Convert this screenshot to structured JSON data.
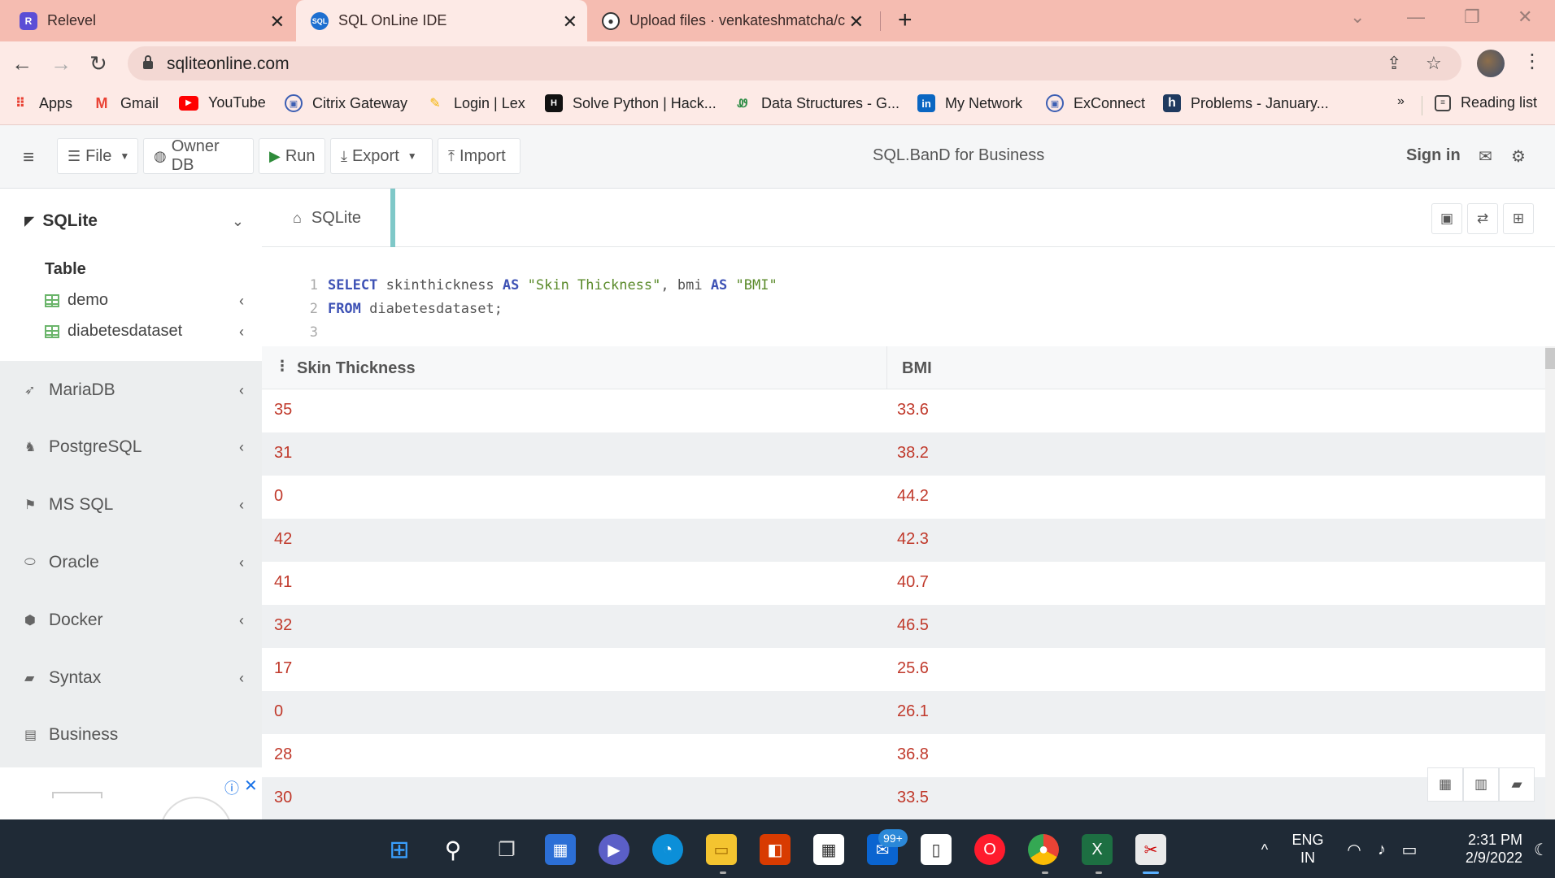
{
  "browser": {
    "tabs": [
      {
        "title": "Relevel",
        "icon": "relevel-icon",
        "active": false
      },
      {
        "title": "SQL OnLine IDE",
        "icon": "sql-cloud-icon",
        "active": true
      },
      {
        "title": "Upload files · venkateshmatcha/c",
        "icon": "github-icon",
        "active": false
      }
    ],
    "url": "sqliteonline.com",
    "bookmarks": [
      {
        "label": "Apps",
        "icon": "apps-grid-icon"
      },
      {
        "label": "Gmail",
        "icon": "gmail-icon"
      },
      {
        "label": "YouTube",
        "icon": "youtube-icon"
      },
      {
        "label": "Citrix Gateway",
        "icon": "citrix-lock-icon"
      },
      {
        "label": "Login | Lex",
        "icon": "lex-icon"
      },
      {
        "label": "Solve Python | Hack...",
        "icon": "hackerrank-icon"
      },
      {
        "label": "Data Structures - G...",
        "icon": "geeksforgeeks-icon"
      },
      {
        "label": "My Network",
        "icon": "linkedin-icon"
      },
      {
        "label": "ExConnect",
        "icon": "exconnect-lock-icon"
      },
      {
        "label": "Problems - January...",
        "icon": "h-icon"
      }
    ],
    "overflow": "»",
    "reading_list": "Reading list"
  },
  "header": {
    "file": "File",
    "owner_db": "Owner DB",
    "run": "Run",
    "export": "Export",
    "import": "Import",
    "brand": "SQL.BanD for Business",
    "sign_in": "Sign in"
  },
  "sidebar": {
    "active_db": "SQLite",
    "table_label": "Table",
    "tables": [
      "demo",
      "diabetesdataset"
    ],
    "databases": [
      {
        "label": "MariaDB",
        "icon": "mariadb-icon"
      },
      {
        "label": "PostgreSQL",
        "icon": "postgresql-icon"
      },
      {
        "label": "MS SQL",
        "icon": "mssql-icon"
      },
      {
        "label": "Oracle",
        "icon": "oracle-icon"
      },
      {
        "label": "Docker",
        "icon": "docker-icon"
      },
      {
        "label": "Syntax",
        "icon": "book-icon"
      },
      {
        "label": "Business",
        "icon": "building-icon"
      }
    ]
  },
  "editor": {
    "tab": "SQLite",
    "lines": [
      {
        "num": "1",
        "kw1": "SELECT",
        "a": " skinthickness ",
        "kw2": "AS",
        "s1": " \"Skin Thickness\"",
        "b": ", bmi ",
        "kw3": "AS",
        "s2": " \"BMI\""
      },
      {
        "num": "2",
        "kw1": "FROM",
        "a": " diabetesdataset;"
      },
      {
        "num": "3"
      }
    ]
  },
  "results": {
    "columns": [
      "Skin Thickness",
      "BMI"
    ],
    "rows": [
      [
        "35",
        "33.6"
      ],
      [
        "31",
        "38.2"
      ],
      [
        "0",
        "44.2"
      ],
      [
        "42",
        "42.3"
      ],
      [
        "41",
        "40.7"
      ],
      [
        "32",
        "46.5"
      ],
      [
        "17",
        "25.6"
      ],
      [
        "0",
        "26.1"
      ],
      [
        "28",
        "36.8"
      ],
      [
        "30",
        "33.5"
      ]
    ]
  },
  "taskbar": {
    "language": "ENG",
    "region": "IN",
    "time": "2:31 PM",
    "date": "2/9/2022",
    "mail_badge": "99+"
  },
  "colors": {
    "tabbar": "#f5bcb1",
    "toolbar": "#fdeae6",
    "accent_teal": "#7fc8c8",
    "result_value": "#c0392b",
    "keyword": "#3e52b5",
    "string": "#5a8a2a"
  }
}
